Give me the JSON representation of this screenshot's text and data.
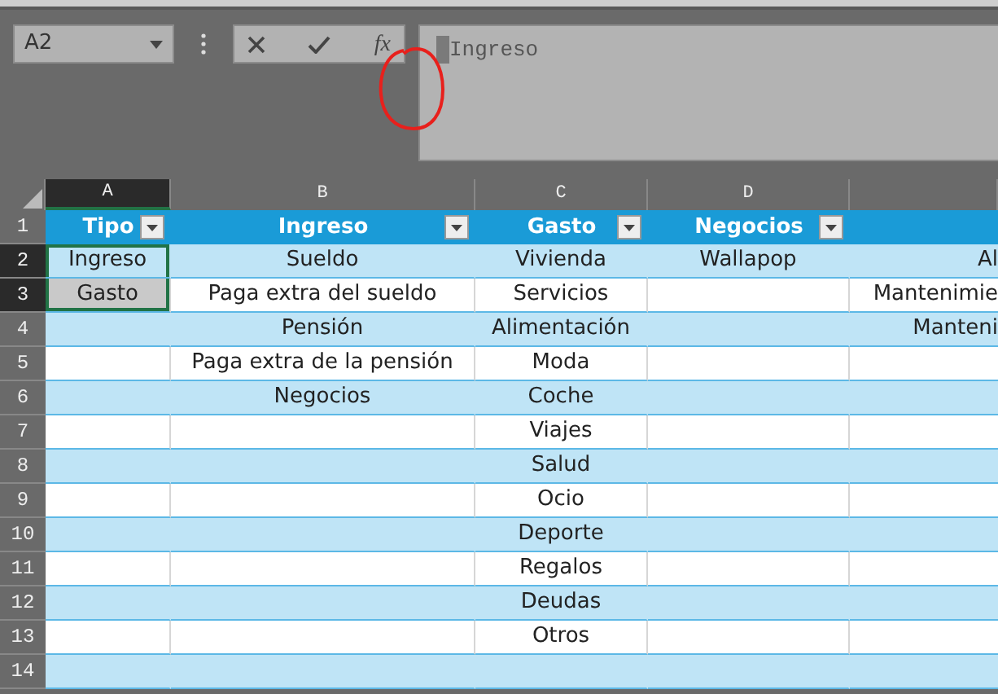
{
  "name_box": {
    "value": "A2"
  },
  "formula_bar": {
    "function_label": "fx",
    "value": "Ingreso"
  },
  "columns": [
    {
      "label": "A",
      "selected": true
    },
    {
      "label": "B",
      "selected": false
    },
    {
      "label": "C",
      "selected": false
    },
    {
      "label": "D",
      "selected": false
    },
    {
      "selected": false
    }
  ],
  "header_row": {
    "number": "1",
    "selected": false,
    "cells": [
      {
        "text": "Tipo",
        "filter": true
      },
      {
        "text": "Ingreso",
        "filter": true
      },
      {
        "text": "Gasto",
        "filter": true
      },
      {
        "text": "Negocios",
        "filter": true
      }
    ]
  },
  "rows": [
    {
      "number": "2",
      "selected": true,
      "active": true,
      "cells": {
        "a": "Ingreso",
        "b": "Sueldo",
        "c": "Vivienda",
        "d": "Wallapop",
        "e": "Al"
      }
    },
    {
      "number": "3",
      "selected": true,
      "active": false,
      "cells": {
        "a": "Gasto",
        "b": "Paga extra del sueldo",
        "c": "Servicios",
        "e": "Mantenimie"
      }
    },
    {
      "number": "4",
      "selected": false,
      "cells": {
        "b": "Pensión",
        "c": "Alimentación",
        "e": "Manteni"
      }
    },
    {
      "number": "5",
      "selected": false,
      "cells": {
        "b": "Paga extra de la pensión",
        "c": "Moda"
      }
    },
    {
      "number": "6",
      "selected": false,
      "cells": {
        "b": "Negocios",
        "c": "Coche"
      }
    },
    {
      "number": "7",
      "selected": false,
      "cells": {
        "c": "Viajes"
      }
    },
    {
      "number": "8",
      "selected": false,
      "cells": {
        "c": "Salud"
      }
    },
    {
      "number": "9",
      "selected": false,
      "cells": {
        "c": "Ocio"
      }
    },
    {
      "number": "10",
      "selected": false,
      "cells": {
        "c": "Deporte"
      }
    },
    {
      "number": "11",
      "selected": false,
      "cells": {
        "c": "Regalos"
      }
    },
    {
      "number": "12",
      "selected": false,
      "cells": {
        "c": "Deudas"
      }
    },
    {
      "number": "13",
      "selected": false,
      "cells": {
        "c": "Otros"
      }
    },
    {
      "number": "14",
      "selected": false,
      "cells": {}
    }
  ]
}
